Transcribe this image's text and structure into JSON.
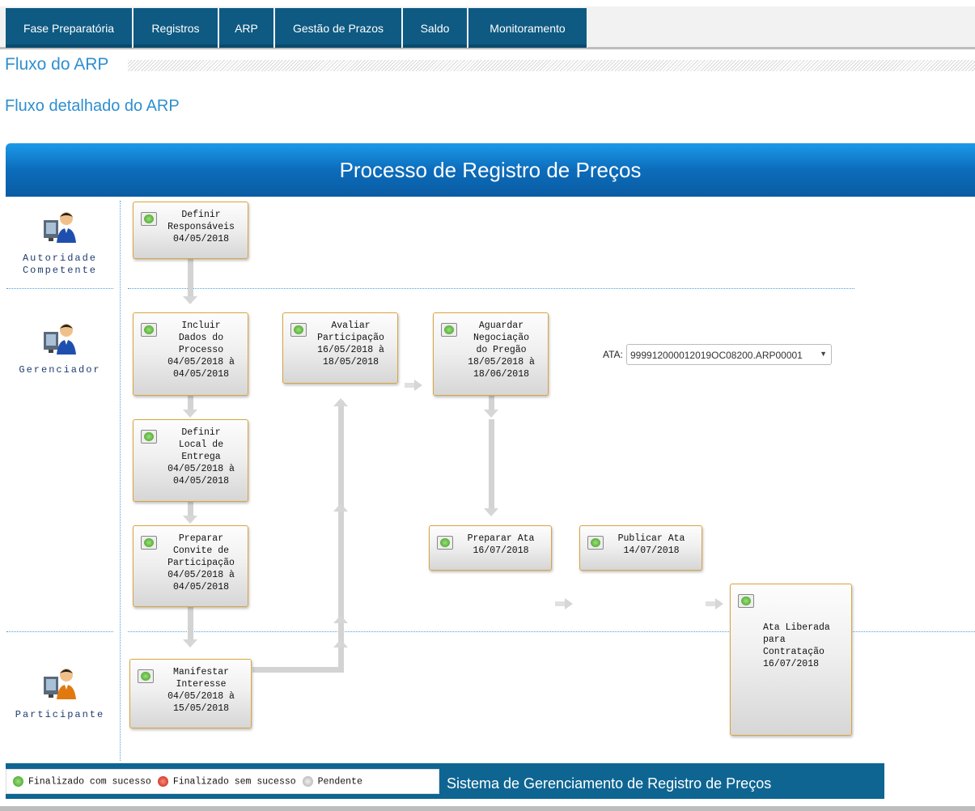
{
  "nav": {
    "tabs": [
      "Fase Preparatória",
      "Registros",
      "ARP",
      "Gestão de Prazos",
      "Saldo",
      "Monitoramento"
    ]
  },
  "section_title": "Fluxo do ARP",
  "subtitle": "Fluxo detalhado do ARP",
  "banner_title": "Processo de Registro de Preços",
  "actors": {
    "autoridade": [
      "Autoridade",
      "Competente"
    ],
    "gerenciador": "Gerenciador",
    "participante": "Participante"
  },
  "steps": {
    "definir_responsaveis": {
      "title": [
        "Definir",
        "Responsáveis"
      ],
      "date": "04/05/2018"
    },
    "incluir_dados": {
      "title": [
        "Incluir",
        "Dados do",
        "Processo"
      ],
      "date": [
        "04/05/2018 à",
        "04/05/2018"
      ]
    },
    "definir_local": {
      "title": [
        "Definir",
        "Local de",
        "Entrega"
      ],
      "date": [
        "04/05/2018 à",
        "04/05/2018"
      ]
    },
    "preparar_convite": {
      "title": [
        "Preparar",
        "Convite de",
        "Participação"
      ],
      "date": [
        "04/05/2018 à",
        "04/05/2018"
      ]
    },
    "avaliar_participacao": {
      "title": [
        "Avaliar",
        "Participação"
      ],
      "date": [
        "16/05/2018 à",
        "18/05/2018"
      ]
    },
    "aguardar_negociacao": {
      "title": [
        "Aguardar",
        "Negociação",
        "do Pregão"
      ],
      "date": [
        "18/05/2018 à",
        "18/06/2018"
      ]
    },
    "preparar_ata": {
      "title": [
        "Preparar Ata"
      ],
      "date": "16/07/2018"
    },
    "publicar_ata": {
      "title": [
        "Publicar Ata"
      ],
      "date": "14/07/2018"
    },
    "ata_liberada": {
      "title": [
        "Ata Liberada",
        "para",
        "Contratação"
      ],
      "date": "16/07/2018"
    },
    "manifestar_interesse": {
      "title": [
        "Manifestar",
        "Interesse"
      ],
      "date": [
        "04/05/2018 à",
        "15/05/2018"
      ]
    }
  },
  "ata": {
    "label": "ATA:",
    "selected": "999912000012019OC08200.ARP00001"
  },
  "legend": {
    "success": "Finalizado com sucesso",
    "failure": "Finalizado sem sucesso",
    "pending": "Pendente"
  },
  "footer_title": "Sistema de Gerenciamento de Registro de Preços",
  "colors": {
    "nav": "#0e5a82",
    "banner": "#0c6cbb",
    "footer": "#0e6592",
    "accent_text": "#2f8fd0",
    "step_border": "#d9a441"
  }
}
